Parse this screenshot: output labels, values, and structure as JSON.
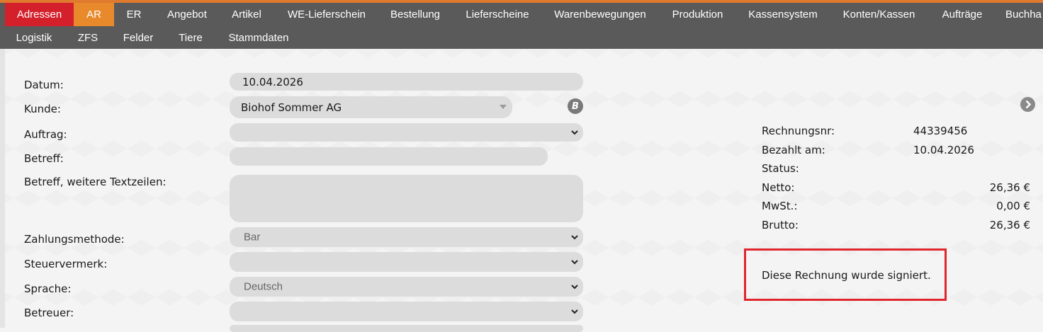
{
  "nav": {
    "row1": [
      {
        "label": "Adressen",
        "bg": "#d3202b"
      },
      {
        "label": "AR",
        "bg": "#e8892b"
      },
      {
        "label": "ER"
      },
      {
        "label": "Angebot"
      },
      {
        "label": "Artikel"
      },
      {
        "label": "WE-Lieferschein"
      },
      {
        "label": "Bestellung"
      },
      {
        "label": "Lieferscheine"
      },
      {
        "label": "Warenbewegungen"
      },
      {
        "label": "Produktion"
      },
      {
        "label": "Kassensystem"
      },
      {
        "label": "Konten/Kassen"
      },
      {
        "label": "Aufträge"
      },
      {
        "label": "Buchha"
      }
    ],
    "row2": [
      {
        "label": "Logistik"
      },
      {
        "label": "ZFS"
      },
      {
        "label": "Felder"
      },
      {
        "label": "Tiere"
      },
      {
        "label": "Stammdaten"
      }
    ]
  },
  "form": {
    "datum": {
      "label": "Datum:",
      "value": "10.04.2026"
    },
    "kunde": {
      "label": "Kunde:",
      "value": "Biohof Sommer AG"
    },
    "auftrag": {
      "label": "Auftrag:",
      "value": ""
    },
    "betreff": {
      "label": "Betreff:",
      "value": ""
    },
    "betreff_weitere": {
      "label": "Betreff, weitere Textzeilen:",
      "value": ""
    },
    "zahlungsmethode": {
      "label": "Zahlungsmethode:",
      "value": "Bar"
    },
    "steuervermerk": {
      "label": "Steuervermerk:",
      "value": ""
    },
    "sprache": {
      "label": "Sprache:",
      "value": "Deutsch"
    },
    "betreuer": {
      "label": "Betreuer:",
      "value": ""
    },
    "kunde_badge": "B"
  },
  "summary": {
    "rechnungsnr": {
      "label": "Rechnungsnr:",
      "value": "44339456"
    },
    "bezahlt_am": {
      "label": "Bezahlt am:",
      "value": "10.04.2026"
    },
    "status": {
      "label": "Status:",
      "value": ""
    },
    "netto": {
      "label": "Netto:",
      "value": "26,36 €"
    },
    "mwst": {
      "label": "MwSt.:",
      "value": "0,00 €"
    },
    "brutto": {
      "label": "Brutto:",
      "value": "26,36 €"
    },
    "signed_notice": "Diese Rechnung wurde signiert.",
    "notice_border_color": "#e0262c"
  },
  "colors": {
    "nav_bg": "#5a5a5a",
    "accent_red": "#d3202b",
    "accent_orange": "#e8892b",
    "field_bg": "#dcdcdc"
  }
}
